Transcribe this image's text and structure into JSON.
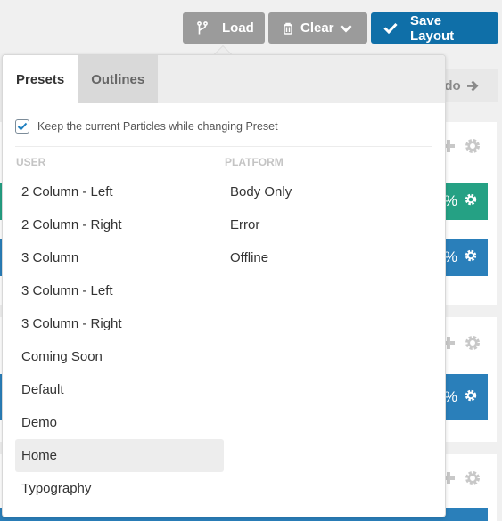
{
  "toolbar": {
    "load_label": "Load",
    "clear_label": "Clear",
    "save_label": "Save Layout"
  },
  "background": {
    "redo_label": "edo",
    "percent_symbol": "%"
  },
  "popover": {
    "tabs": [
      {
        "label": "Presets",
        "active": true
      },
      {
        "label": "Outlines",
        "active": false
      }
    ],
    "keep_particles_label": "Keep the current Particles while changing Preset",
    "keep_particles_checked": true,
    "user_header": "USER",
    "platform_header": "PLATFORM",
    "user_presets": [
      "2 Column - Left",
      "2 Column - Right",
      "3 Column",
      "3 Column - Left",
      "3 Column - Right",
      "Coming Soon",
      "Default",
      "Demo",
      "Home",
      "Typography"
    ],
    "platform_presets": [
      "Body Only",
      "Error",
      "Offline"
    ],
    "hovered_item": "Home"
  },
  "colors": {
    "primary_blue": "#0f6fa8",
    "gray_button": "#9b9b9b",
    "green_block": "#25a184",
    "blue_block": "#2a7fba",
    "check_blue": "#1e7fc0"
  }
}
